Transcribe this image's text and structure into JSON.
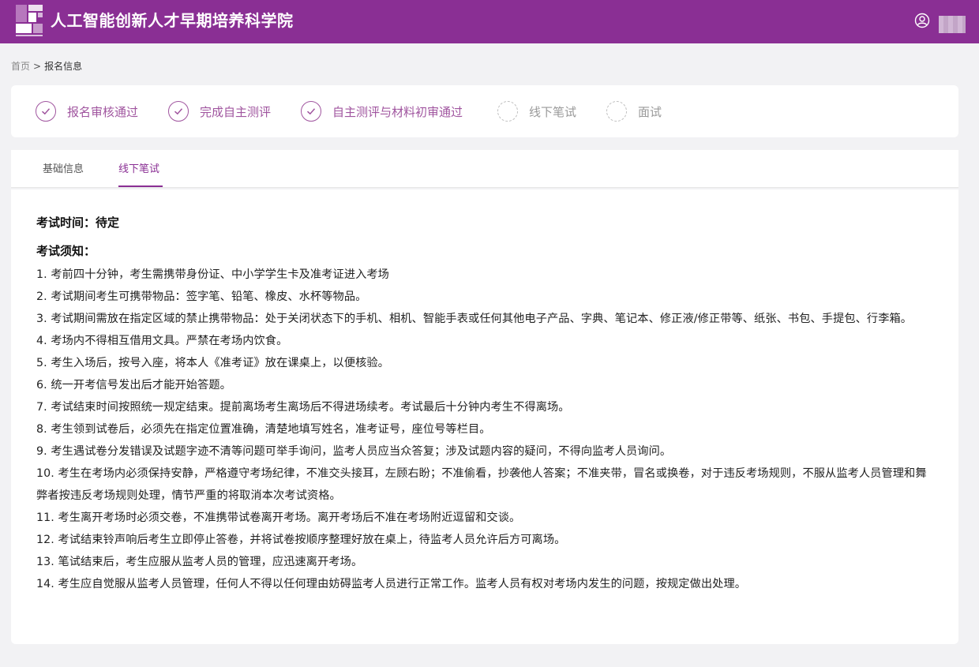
{
  "header": {
    "site_title": "人工智能创新人才早期培养科学院",
    "logo_icon": "academy-logo-icon",
    "user_icon": "user-circle-icon",
    "brand_color": "#8a2f94"
  },
  "breadcrumb": {
    "home": "首页",
    "separator": ">",
    "current": "报名信息"
  },
  "steps": [
    {
      "label": "报名审核通过",
      "status": "done"
    },
    {
      "label": "完成自主测评",
      "status": "done"
    },
    {
      "label": "自主测评与材料初审通过",
      "status": "done"
    },
    {
      "label": "线下笔试",
      "status": "pending"
    },
    {
      "label": "面试",
      "status": "pending"
    }
  ],
  "tabs": [
    {
      "label": "基础信息",
      "active": false
    },
    {
      "label": "线下笔试",
      "active": true
    }
  ],
  "exam": {
    "time_label": "考试时间：待定",
    "notice_title": "考试须知：",
    "rules": [
      "1. 考前四十分钟，考生需携带身份证、中小学学生卡及准考证进入考场",
      "2. 考试期间考生可携带物品：签字笔、铅笔、橡皮、水杯等物品。",
      "3. 考试期间需放在指定区域的禁止携带物品：处于关闭状态下的手机、相机、智能手表或任何其他电子产品、字典、笔记本、修正液/修正带等、纸张、书包、手提包、行李箱。",
      "4. 考场内不得相互借用文具。严禁在考场内饮食。",
      "5. 考生入场后，按号入座，将本人《准考证》放在课桌上，以便核验。",
      "6. 统一开考信号发出后才能开始答题。",
      "7. 考试结束时间按照统一规定结束。提前离场考生离场后不得进场续考。考试最后十分钟内考生不得离场。",
      "8. 考生领到试卷后，必须先在指定位置准确，清楚地填写姓名，准考证号，座位号等栏目。",
      "9. 考生遇试卷分发错误及试题字迹不清等问题可举手询问，监考人员应当众答复；涉及试题内容的疑问，不得向监考人员询问。",
      "10. 考生在考场内必须保持安静，严格遵守考场纪律，不准交头接耳，左顾右盼；不准偷看，抄袭他人答案；不准夹带，冒名或换卷，对于违反考场规则，不服从监考人员管理和舞弊者按违反考场规则处理，情节严重的将取消本次考试资格。",
      "11. 考生离开考场时必须交卷，不准携带试卷离开考场。离开考场后不准在考场附近逗留和交谈。",
      "12. 考试结束铃声响后考生立即停止答卷，并将试卷按顺序整理好放在桌上，待监考人员允许后方可离场。",
      "13. 笔试结束后，考生应服从监考人员的管理，应迅速离开考场。",
      "14. 考生应自觉服从监考人员管理，任何人不得以任何理由妨碍监考人员进行正常工作。监考人员有权对考场内发生的问题，按规定做出处理。"
    ]
  }
}
